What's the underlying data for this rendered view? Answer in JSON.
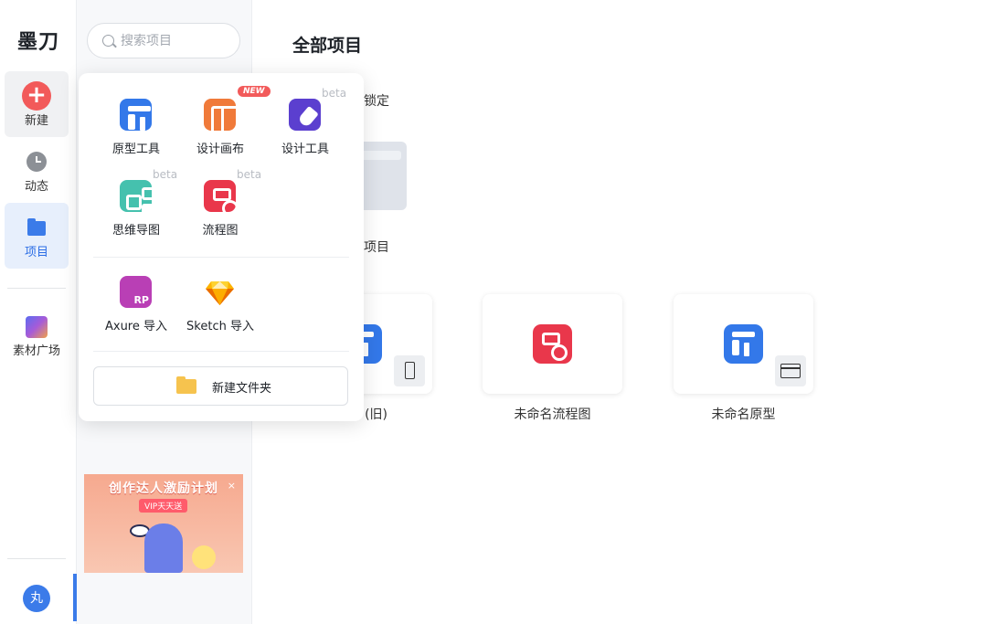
{
  "rail": {
    "logo": "墨刀",
    "items": [
      {
        "label": "新建",
        "icon": "plus-icon"
      },
      {
        "label": "动态",
        "icon": "clock-icon"
      },
      {
        "label": "项目",
        "icon": "folder-icon"
      },
      {
        "label": "素材广场",
        "icon": "assets-icon"
      }
    ],
    "avatar": "丸"
  },
  "search": {
    "placeholder": "搜索项目"
  },
  "banner": {
    "title": "创作达人激励计划",
    "badge": "VIP天天送",
    "close": "×"
  },
  "main": {
    "title": "全部项目",
    "pinned_fragment": "锁定",
    "folder_name_fragment": "项目",
    "cards": [
      {
        "label_fragment": "(旧)",
        "icon": "prototype-icon",
        "device": "phone-icon"
      },
      {
        "label": "未命名流程图",
        "icon": "flowchart-icon"
      },
      {
        "label": "未命名原型",
        "icon": "prototype-icon",
        "device": "browser-icon"
      }
    ]
  },
  "popup": {
    "tools": [
      {
        "label": "原型工具",
        "icon": "prototype-icon"
      },
      {
        "label": "设计画布",
        "icon": "design-canvas-icon",
        "tag": "NEW"
      },
      {
        "label": "设计工具",
        "icon": "design-tool-icon",
        "tag": "beta"
      },
      {
        "label": "思维导图",
        "icon": "mindmap-icon",
        "tag": "beta"
      },
      {
        "label": "流程图",
        "icon": "flowchart-icon",
        "tag": "beta"
      }
    ],
    "imports": [
      {
        "label": "Axure 导入",
        "icon": "axure-icon"
      },
      {
        "label": "Sketch 导入",
        "icon": "sketch-icon"
      }
    ],
    "new_folder": "新建文件夹"
  },
  "colors": {
    "accent": "#3b7be9",
    "new_button": "#f25a5a"
  }
}
